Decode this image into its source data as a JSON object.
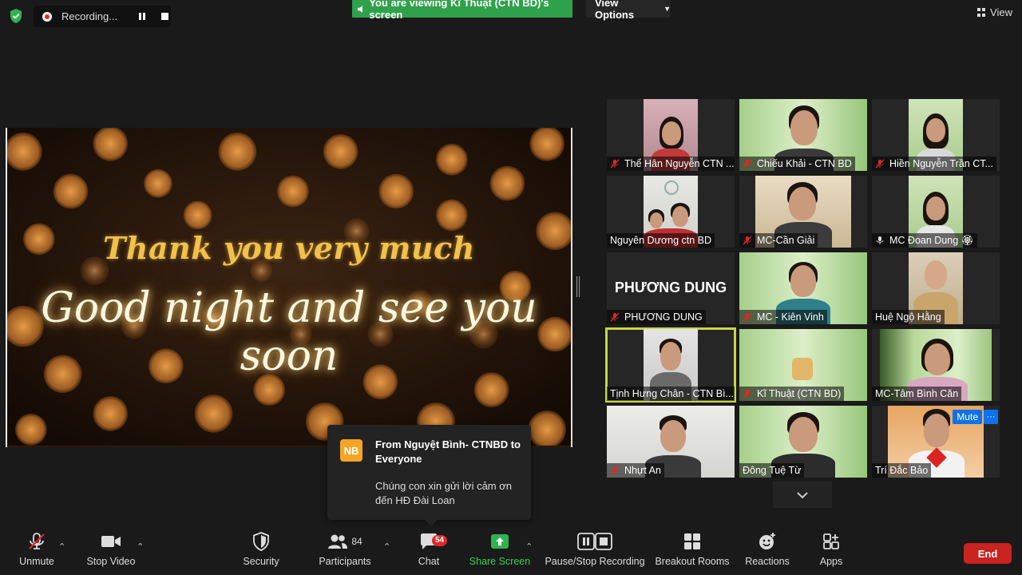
{
  "top_bar": {
    "recording_label": "Recording...",
    "viewing_banner": "You are viewing Kĩ Thuật (CTN BD)'s screen",
    "view_options_label": "View Options",
    "view_label": "View"
  },
  "shared_screen": {
    "line1": "Thank you very much",
    "line2": "Good night and see you soon"
  },
  "gallery": {
    "participants": [
      {
        "name": "Thể Hân Nguyễn CTN ...",
        "muted": true
      },
      {
        "name": "Chiếu Khải - CTN BD",
        "muted": true
      },
      {
        "name": "Hiền Nguyễn Trần CT...",
        "muted": true
      },
      {
        "name": "Nguyên Dương ctn BD",
        "muted": false
      },
      {
        "name": "MC-Cần Giải",
        "muted": true
      },
      {
        "name": "MC Đoan Dung 🏵",
        "muted": true
      },
      {
        "name": "PHƯƠNG DUNG",
        "muted": true,
        "big_name": "PHƯƠNG DUNG"
      },
      {
        "name": "MC - Kiên Vinh",
        "muted": true
      },
      {
        "name": "Huệ Ngộ Hằng",
        "muted": false
      },
      {
        "name": "Tịnh Hưng Chân - CTN Bì...",
        "muted": false,
        "active_speaker": true
      },
      {
        "name": "Kĩ Thuật (CTN BD)",
        "muted": true
      },
      {
        "name": "MC-Tâm Bình Căn",
        "muted": false
      },
      {
        "name": "Nhựt An",
        "muted": true
      },
      {
        "name": "Đông Tuệ Từ",
        "muted": false
      },
      {
        "name": "Trí Đắc Bảo",
        "muted": false
      }
    ],
    "mute_button_label": "Mute",
    "more_button_label": "···"
  },
  "chat_notification": {
    "avatar_initials": "NB",
    "from": "From Nguyệt Bình- CTNBD to Everyone",
    "message": "Chúng con xin gửi lời cảm ơn đến HĐ Đài Loan"
  },
  "toolbar": {
    "unmute": "Unmute",
    "stop_video": "Stop Video",
    "security": "Security",
    "participants": "Participants",
    "participants_count": "84",
    "chat": "Chat",
    "chat_badge": "54",
    "share_screen": "Share Screen",
    "pause_stop_recording": "Pause/Stop Recording",
    "breakout_rooms": "Breakout Rooms",
    "reactions": "Reactions",
    "apps": "Apps",
    "end": "End"
  },
  "colors": {
    "accent_green": "#2fa14a",
    "share_green": "#3ccf5a",
    "end_red": "#c92420",
    "badge_red": "#e02828",
    "active_speaker": "#c4d64a",
    "mute_blue": "#0e72ed",
    "avatar_orange": "#f5a524"
  }
}
